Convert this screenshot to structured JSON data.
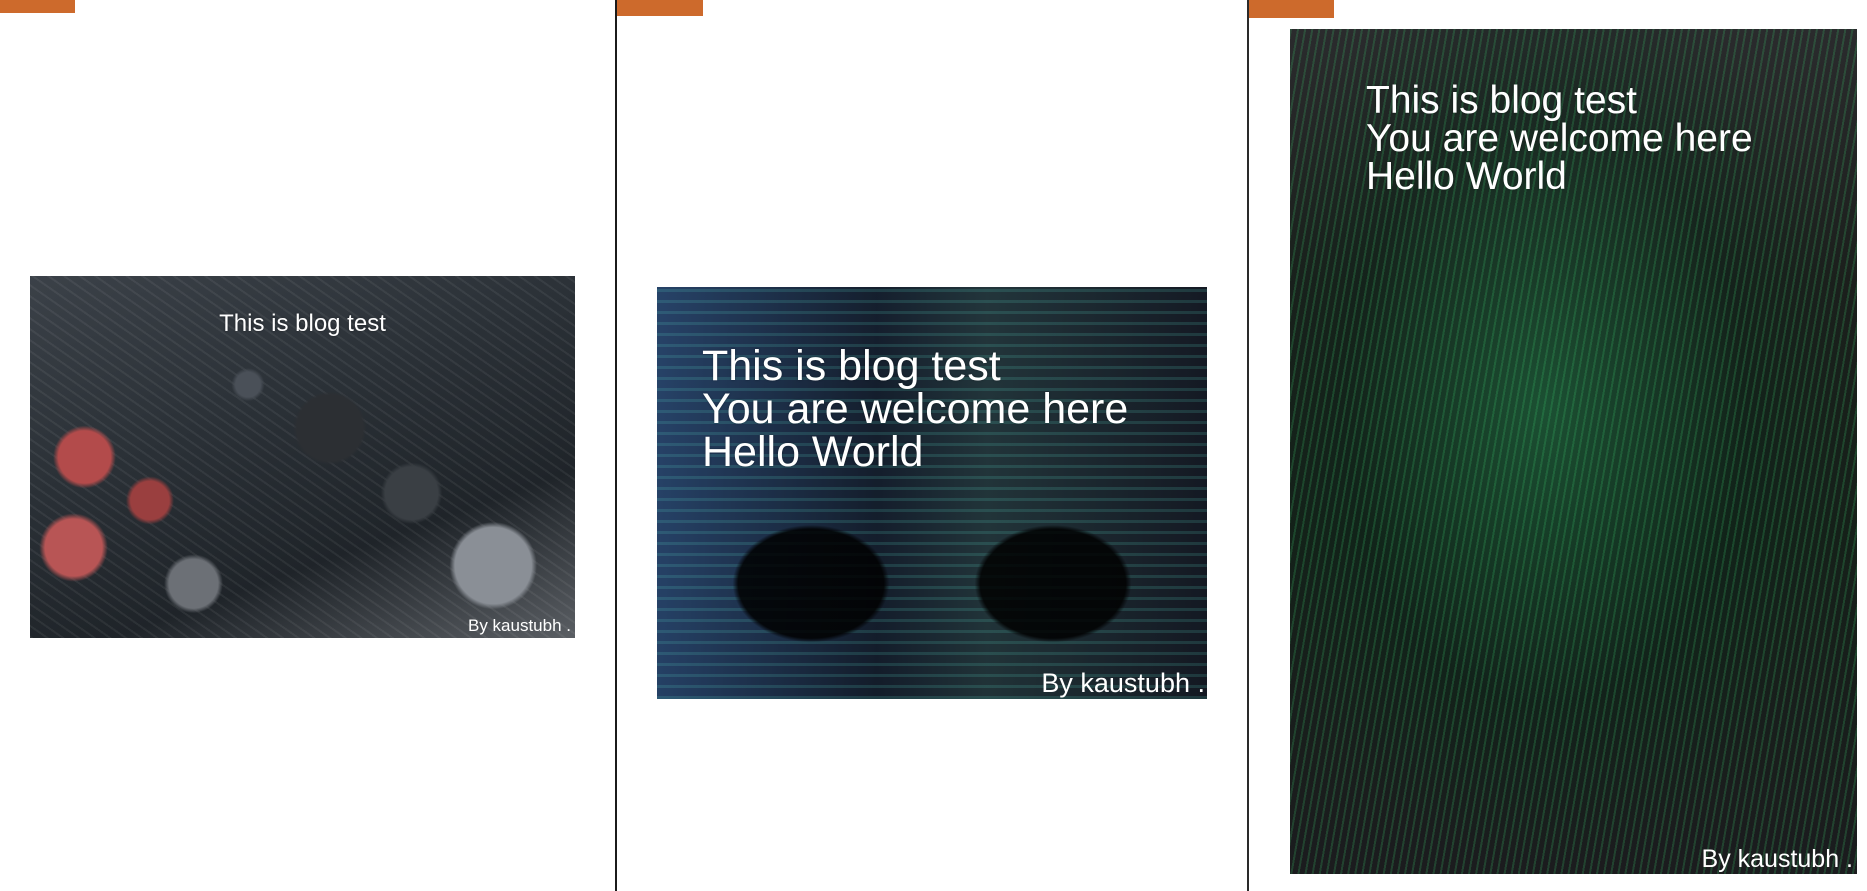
{
  "colors": {
    "accent": "#cd6a2c",
    "divider": "#1b1b1b",
    "text": "#ffffff"
  },
  "cards": [
    {
      "lines": [
        "This is blog test"
      ],
      "byline": "By kaustubh ."
    },
    {
      "lines": [
        "This is blog test",
        "You are welcome here",
        "Hello World"
      ],
      "byline": "By kaustubh ."
    },
    {
      "lines": [
        "This is blog test",
        "You are welcome here",
        "Hello World"
      ],
      "byline": "By kaustubh ."
    }
  ]
}
